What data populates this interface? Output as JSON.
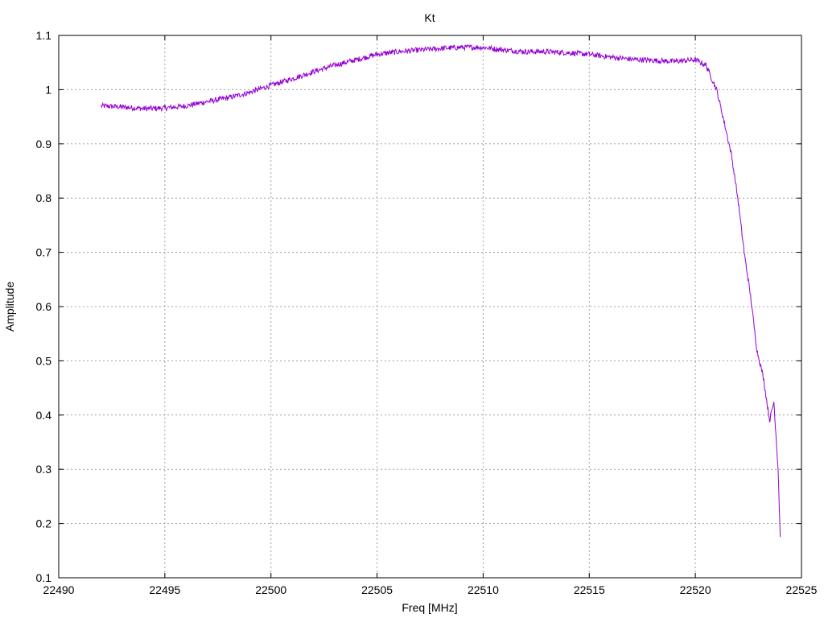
{
  "chart_data": {
    "type": "line",
    "title": "Kt",
    "xlabel": "Freq [MHz]",
    "ylabel": "Amplitude",
    "xlim": [
      22490,
      22525
    ],
    "ylim": [
      0.1,
      1.1
    ],
    "x_ticks": [
      22490,
      22495,
      22500,
      22505,
      22510,
      22515,
      22520,
      22525
    ],
    "y_ticks": [
      0.1,
      0.2,
      0.3,
      0.4,
      0.5,
      0.6,
      0.7,
      0.8,
      0.9,
      1,
      1.1
    ],
    "x_tick_labels": [
      "22490",
      "22495",
      "22500",
      "22505",
      "22510",
      "22515",
      "22520",
      "22525"
    ],
    "y_tick_labels": [
      "0.1",
      "0.2",
      "0.3",
      "0.4",
      "0.5",
      "0.6",
      "0.7",
      "0.8",
      "0.9",
      "1",
      "1.1"
    ],
    "grid": true,
    "series": [
      {
        "color": "#9400d3",
        "x": [
          22492,
          22493,
          22494,
          22495,
          22496,
          22497,
          22498,
          22499,
          22500,
          22501,
          22502,
          22503,
          22504,
          22505,
          22506,
          22507,
          22508,
          22509,
          22510,
          22511,
          22512,
          22513,
          22514,
          22515,
          22516,
          22517,
          22518,
          22519,
          22520,
          22520.5,
          22521,
          22521.3,
          22521.7,
          22522,
          22522.3,
          22522.6,
          22522.9,
          22523.2,
          22523.5,
          22523.7,
          22523.9,
          22524
        ],
        "y": [
          0.97,
          0.968,
          0.965,
          0.966,
          0.97,
          0.978,
          0.985,
          0.995,
          1.008,
          1.02,
          1.033,
          1.045,
          1.055,
          1.065,
          1.07,
          1.073,
          1.076,
          1.078,
          1.078,
          1.073,
          1.07,
          1.07,
          1.068,
          1.065,
          1.06,
          1.056,
          1.054,
          1.052,
          1.055,
          1.045,
          1.0,
          0.95,
          0.88,
          0.8,
          0.7,
          0.62,
          0.52,
          0.47,
          0.39,
          0.425,
          0.3,
          0.175
        ]
      }
    ]
  }
}
